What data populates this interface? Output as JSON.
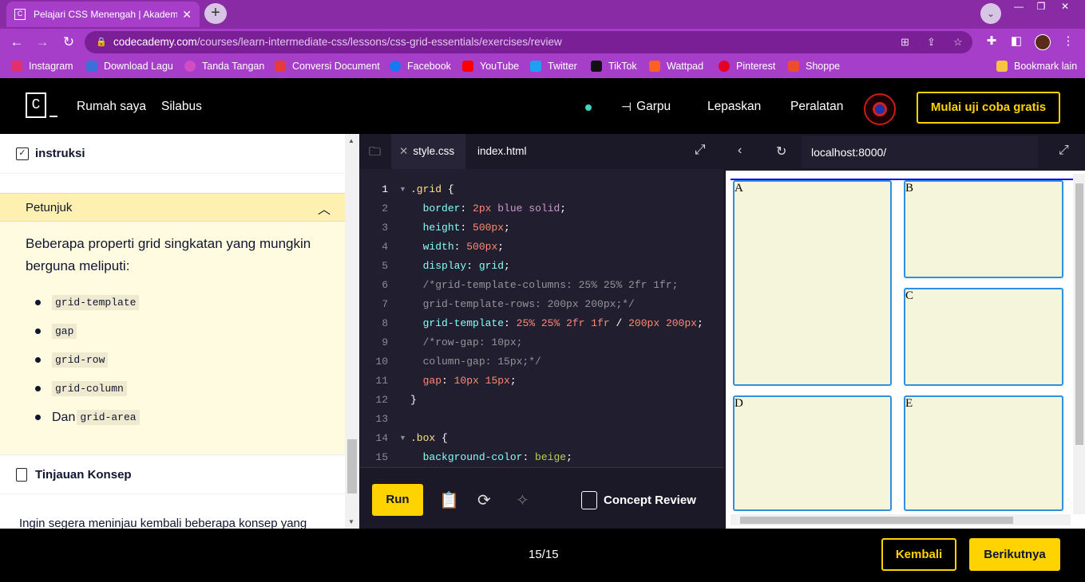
{
  "browser": {
    "tab_title": "Pelajari CSS Menengah | Akadem",
    "tab_favicon": "C",
    "new_tab": "+",
    "url_host": "codecademy.com",
    "url_path": "/courses/learn-intermediate-css/lessons/css-grid-essentials/exercises/review",
    "bookmarks": [
      "Instagram",
      "Download Lagu",
      "Tanda Tangan",
      "Conversi Document",
      "Facebook",
      "YouTube",
      "Twitter",
      "TikTok",
      "Wattpad",
      "Pinterest",
      "Shoppe"
    ],
    "bookmarks_other": "Bookmark lain"
  },
  "nav": {
    "logo": "C",
    "links": [
      "Rumah saya",
      "Silabus"
    ],
    "fork": "Garpu",
    "release": "Lepaskan",
    "tools": "Peralatan",
    "trial": "Mulai uji coba gratis"
  },
  "lesson": {
    "instructions_title": "instruksi",
    "hint_title": "Petunjuk",
    "hint_text": "Beberapa properti grid singkatan yang mungkin berguna meliputi:",
    "hint_items": [
      "grid-template",
      "gap",
      "grid-row",
      "grid-column"
    ],
    "hint_last_prefix": "Dan",
    "hint_last_code": "grid-area",
    "concept_title": "Tinjauan Konsep",
    "footer_text": "Ingin segera meninjau kembali beberapa konsep yang"
  },
  "editor": {
    "tabs": [
      "style.css",
      "index.html"
    ],
    "run": "Run",
    "concept_review": "Concept Review",
    "line_numbers": [
      "1",
      "2",
      "3",
      "4",
      "5",
      "6",
      "7",
      "8",
      "9",
      "10",
      "11",
      "12",
      "13",
      "14",
      "15"
    ]
  },
  "preview": {
    "url": "localhost:8000/",
    "boxes": [
      "A",
      "B",
      "C",
      "D",
      "E"
    ]
  },
  "footer": {
    "progress": "15/15",
    "back": "Kembali",
    "next": "Berikutnya"
  },
  "colors": {
    "accent": "#ffd300",
    "chrome": "#a73ec9",
    "editor_bg": "#211e2f"
  }
}
